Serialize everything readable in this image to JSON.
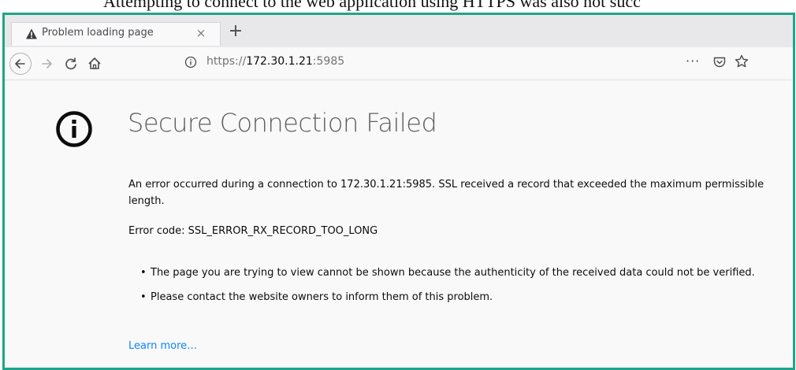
{
  "caption": {
    "text": "Attempting to connect to the web application using HTTPS was also not succ"
  },
  "browser": {
    "tab": {
      "title": "Problem loading page",
      "close_glyph": "×",
      "icon": "warning-triangle-icon"
    },
    "new_tab_glyph": "+",
    "toolbar": {
      "back_icon": "back-arrow-icon",
      "forward_icon": "forward-arrow-icon",
      "reload_icon": "reload-icon",
      "home_icon": "home-icon"
    },
    "urlbar": {
      "scheme": "https://",
      "host": "172.30.1.21",
      "port": ":5985",
      "page_actions_glyph": "···",
      "info_icon": "info-circle-icon",
      "pocket_icon": "pocket-icon",
      "bookmark_icon": "star-icon"
    }
  },
  "error_page": {
    "icon": "info-circle-icon",
    "title": "Secure Connection Failed",
    "description": "An error occurred during a connection to 172.30.1.21:5985. SSL received a record that exceeded the maximum permissible length.",
    "error_code": "Error code: SSL_ERROR_RX_RECORD_TOO_LONG",
    "bullets": [
      "The page you are trying to view cannot be shown because the authenticity of the received data could not be verified.",
      "Please contact the website owners to inform them of this problem."
    ],
    "learn_more": "Learn more…"
  },
  "colors": {
    "frame_border": "#1fa58b",
    "link": "#0a84ff",
    "heading": "#5f5f63"
  }
}
